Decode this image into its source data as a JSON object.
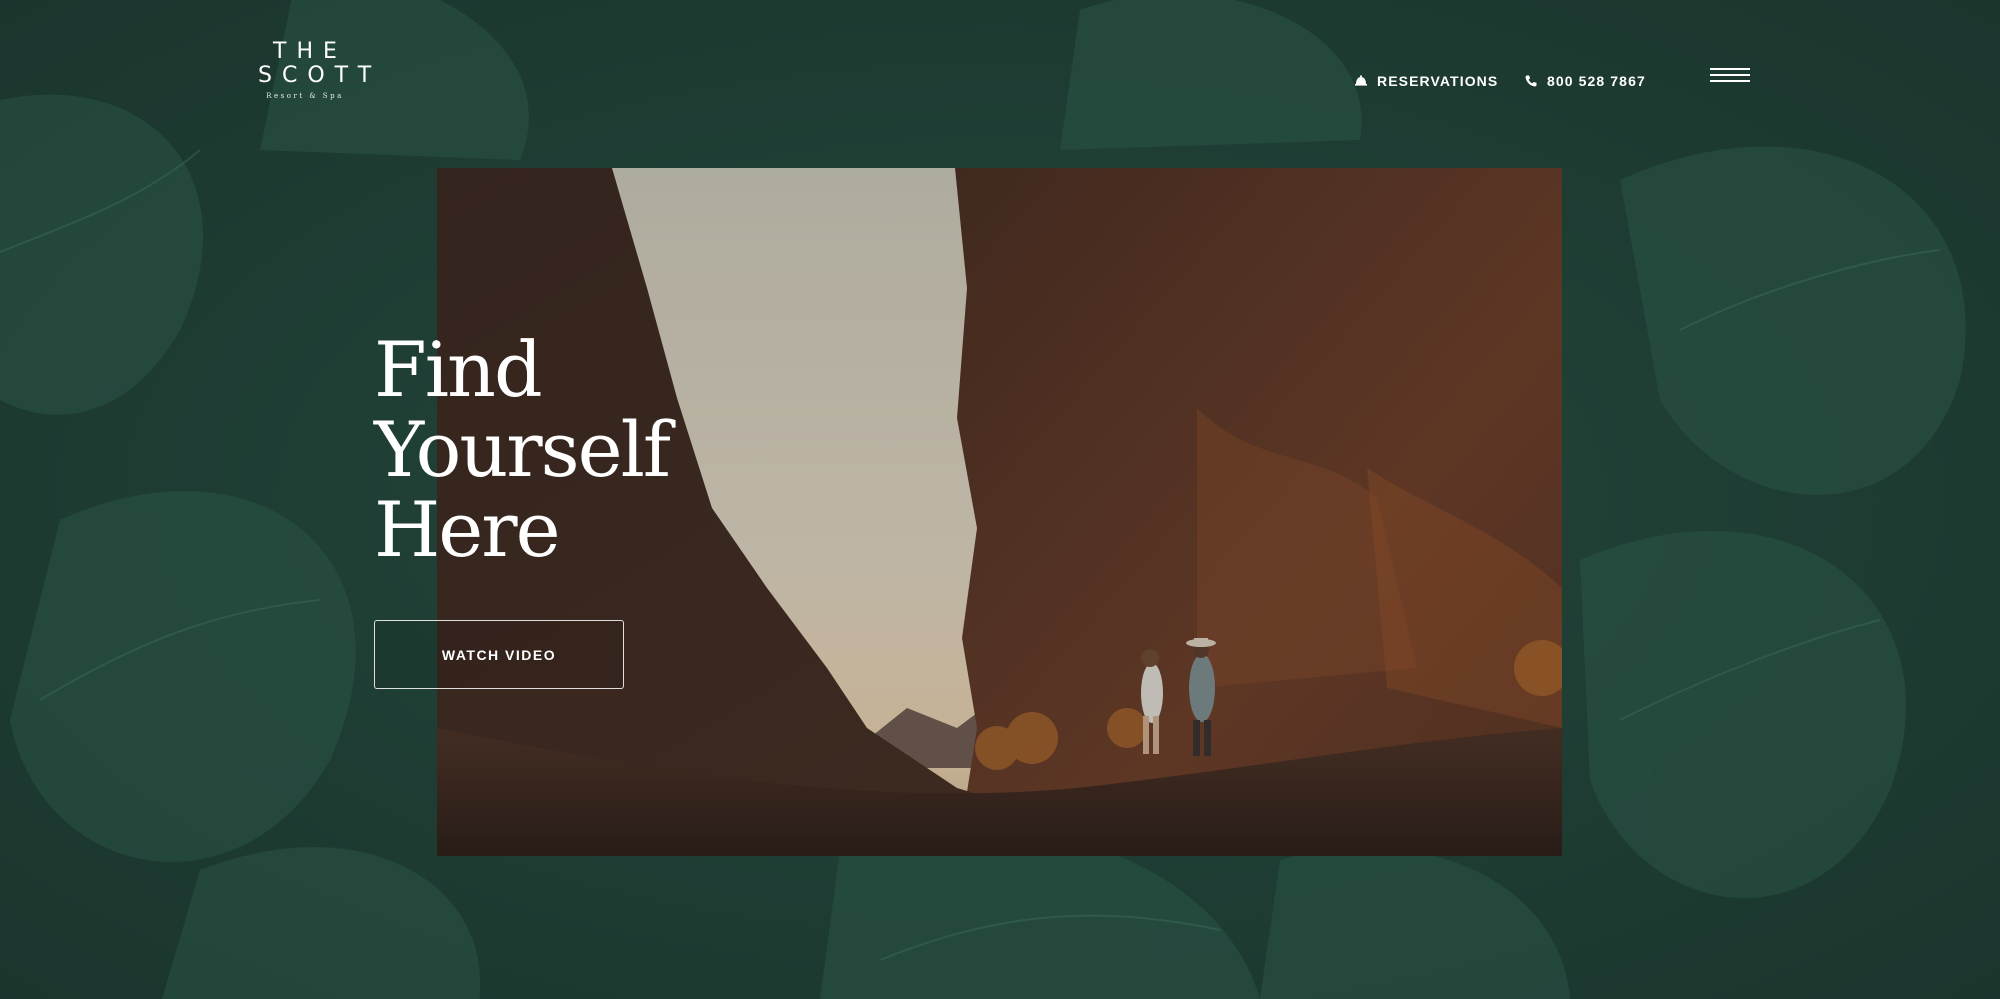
{
  "brand": {
    "line1": "THE",
    "line2": "SCOTT",
    "sub": "Resort & Spa"
  },
  "nav": {
    "reservations": "RESERVATIONS",
    "phone": "800 528 7867",
    "reservations_icon": "bell-icon",
    "phone_icon": "phone-icon",
    "menu_icon": "hamburger-menu-icon"
  },
  "hero": {
    "title_lines": [
      "Find",
      "Yourself",
      "Here"
    ],
    "cta": "WATCH VIDEO"
  },
  "colors": {
    "background": "#1f3d34",
    "text": "#ffffff"
  }
}
